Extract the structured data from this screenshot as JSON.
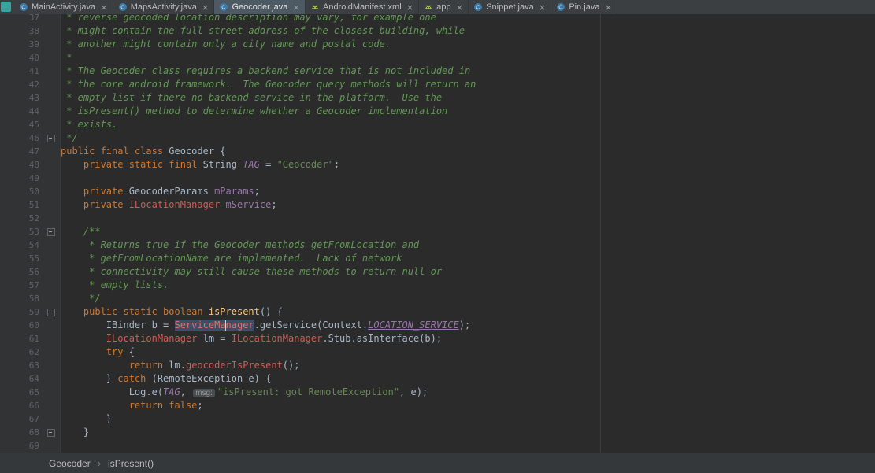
{
  "theme": {
    "background": "#2B2B2B",
    "gutter": "#313335",
    "tab_bar": "#3C3F41",
    "active_tab": "#4D5A63",
    "keyword": "#CC7832",
    "string": "#6A8759",
    "comment": "#629755",
    "error": "#CF5B56",
    "field": "#9876AA",
    "method": "#FFC66D",
    "default_text": "#A9B7C6",
    "selection": "#3A5067",
    "android_icon_green": "#9FBF3B",
    "class_icon_blue": "#3C7BA8",
    "corner_icon_teal": "#3AA3A0"
  },
  "tabs": [
    {
      "label": "MainActivity.java",
      "icon": "class",
      "active": false
    },
    {
      "label": "MapsActivity.java",
      "icon": "class",
      "active": false
    },
    {
      "label": "Geocoder.java",
      "icon": "class",
      "active": true
    },
    {
      "label": "AndroidManifest.xml",
      "icon": "android",
      "active": false
    },
    {
      "label": "app",
      "icon": "android",
      "active": false
    },
    {
      "label": "Snippet.java",
      "icon": "class",
      "active": false
    },
    {
      "label": "Pin.java",
      "icon": "class",
      "active": false
    }
  ],
  "breadcrumbs": [
    "Geocoder",
    "isPresent()"
  ],
  "editor": {
    "lines": [
      {
        "num": 37,
        "fold": null,
        "tokens": [
          {
            "t": " * reverse geocoded location description may vary, for example one",
            "c": "com"
          }
        ]
      },
      {
        "num": 38,
        "fold": null,
        "tokens": [
          {
            "t": " * might contain the full street address of the closest building, while",
            "c": "com"
          }
        ]
      },
      {
        "num": 39,
        "fold": null,
        "tokens": [
          {
            "t": " * another might contain only a city name and postal code.",
            "c": "com"
          }
        ]
      },
      {
        "num": 40,
        "fold": null,
        "tokens": [
          {
            "t": " *",
            "c": "com"
          }
        ]
      },
      {
        "num": 41,
        "fold": null,
        "tokens": [
          {
            "t": " * The Geocoder class requires a backend service that is not included in",
            "c": "com"
          }
        ]
      },
      {
        "num": 42,
        "fold": null,
        "tokens": [
          {
            "t": " * the core android framework.  The Geocoder query methods will return an",
            "c": "com"
          }
        ]
      },
      {
        "num": 43,
        "fold": null,
        "tokens": [
          {
            "t": " * empty list if there no backend service in the platform.  Use the",
            "c": "com"
          }
        ]
      },
      {
        "num": 44,
        "fold": null,
        "tokens": [
          {
            "t": " * isPresent() method to determine whether a Geocoder implementation",
            "c": "com"
          }
        ]
      },
      {
        "num": 45,
        "fold": null,
        "tokens": [
          {
            "t": " * exists.",
            "c": "com"
          }
        ]
      },
      {
        "num": 46,
        "fold": "minus",
        "tokens": [
          {
            "t": " */",
            "c": "com"
          }
        ]
      },
      {
        "num": 47,
        "fold": null,
        "tokens": [
          {
            "t": "public final class ",
            "c": "kw"
          },
          {
            "t": "Geocoder {",
            "c": "def"
          }
        ]
      },
      {
        "num": 48,
        "fold": null,
        "tokens": [
          {
            "t": "    ",
            "c": "def"
          },
          {
            "t": "private static final ",
            "c": "kw"
          },
          {
            "t": "String ",
            "c": "def"
          },
          {
            "t": "TAG",
            "c": "sfld"
          },
          {
            "t": " = ",
            "c": "def"
          },
          {
            "t": "\"Geocoder\"",
            "c": "str"
          },
          {
            "t": ";",
            "c": "def"
          }
        ]
      },
      {
        "num": 49,
        "fold": null,
        "tokens": []
      },
      {
        "num": 50,
        "fold": null,
        "tokens": [
          {
            "t": "    ",
            "c": "def"
          },
          {
            "t": "private ",
            "c": "kw"
          },
          {
            "t": "GeocoderParams ",
            "c": "def"
          },
          {
            "t": "mParams",
            "c": "fld"
          },
          {
            "t": ";",
            "c": "def"
          }
        ]
      },
      {
        "num": 51,
        "fold": null,
        "tokens": [
          {
            "t": "    ",
            "c": "def"
          },
          {
            "t": "private ",
            "c": "kw"
          },
          {
            "t": "ILocationManager",
            "c": "err"
          },
          {
            "t": " ",
            "c": "def"
          },
          {
            "t": "mService",
            "c": "fld"
          },
          {
            "t": ";",
            "c": "def"
          }
        ]
      },
      {
        "num": 52,
        "fold": null,
        "tokens": []
      },
      {
        "num": 53,
        "fold": "minus",
        "tokens": [
          {
            "t": "    /**",
            "c": "com"
          }
        ]
      },
      {
        "num": 54,
        "fold": null,
        "tokens": [
          {
            "t": "     * Returns true if the Geocoder methods getFromLocation and",
            "c": "com"
          }
        ]
      },
      {
        "num": 55,
        "fold": null,
        "tokens": [
          {
            "t": "     * getFromLocationName are implemented.  Lack of network",
            "c": "com"
          }
        ]
      },
      {
        "num": 56,
        "fold": null,
        "tokens": [
          {
            "t": "     * connectivity may still cause these methods to return null or",
            "c": "com"
          }
        ]
      },
      {
        "num": 57,
        "fold": null,
        "tokens": [
          {
            "t": "     * empty lists.",
            "c": "com"
          }
        ]
      },
      {
        "num": 58,
        "fold": null,
        "tokens": [
          {
            "t": "     */",
            "c": "com"
          }
        ]
      },
      {
        "num": 59,
        "fold": "minus",
        "tokens": [
          {
            "t": "    ",
            "c": "def"
          },
          {
            "t": "public static boolean ",
            "c": "kw"
          },
          {
            "t": "isPresent",
            "c": "meth"
          },
          {
            "t": "() {",
            "c": "def"
          }
        ]
      },
      {
        "num": 60,
        "fold": null,
        "tokens": [
          {
            "t": "        IBinder b = ",
            "c": "def"
          },
          {
            "t": "ServiceMa",
            "c": "errsel"
          },
          {
            "t": "",
            "c": "caret"
          },
          {
            "t": "nager",
            "c": "errsel"
          },
          {
            "t": ".getService(Context.",
            "c": "def"
          },
          {
            "t": "LOCATION_SERVICE",
            "c": "cst"
          },
          {
            "t": ");",
            "c": "def"
          }
        ]
      },
      {
        "num": 61,
        "fold": null,
        "tokens": [
          {
            "t": "        ",
            "c": "def"
          },
          {
            "t": "ILocationManager",
            "c": "err"
          },
          {
            "t": " lm = ",
            "c": "def"
          },
          {
            "t": "ILocationManager",
            "c": "err"
          },
          {
            "t": ".Stub.asInterface(b);",
            "c": "def"
          }
        ]
      },
      {
        "num": 62,
        "fold": null,
        "tokens": [
          {
            "t": "        ",
            "c": "def"
          },
          {
            "t": "try ",
            "c": "kw"
          },
          {
            "t": "{",
            "c": "def"
          }
        ]
      },
      {
        "num": 63,
        "fold": null,
        "tokens": [
          {
            "t": "            ",
            "c": "def"
          },
          {
            "t": "return ",
            "c": "kw"
          },
          {
            "t": "lm.",
            "c": "def"
          },
          {
            "t": "geocoderIsPresent",
            "c": "err"
          },
          {
            "t": "();",
            "c": "def"
          }
        ]
      },
      {
        "num": 64,
        "fold": null,
        "tokens": [
          {
            "t": "        } ",
            "c": "def"
          },
          {
            "t": "catch ",
            "c": "kw"
          },
          {
            "t": "(RemoteException e) {",
            "c": "def"
          }
        ]
      },
      {
        "num": 65,
        "fold": null,
        "tokens": [
          {
            "t": "            Log.e(",
            "c": "def"
          },
          {
            "t": "TAG",
            "c": "sfld"
          },
          {
            "t": ", ",
            "c": "def"
          },
          {
            "t": "msg:",
            "c": "hint"
          },
          {
            "t": "\"isPresent: got RemoteException\"",
            "c": "str"
          },
          {
            "t": ", e);",
            "c": "def"
          }
        ]
      },
      {
        "num": 66,
        "fold": null,
        "tokens": [
          {
            "t": "            ",
            "c": "def"
          },
          {
            "t": "return false",
            "c": "kw"
          },
          {
            "t": ";",
            "c": "def"
          }
        ]
      },
      {
        "num": 67,
        "fold": null,
        "tokens": [
          {
            "t": "        }",
            "c": "def"
          }
        ]
      },
      {
        "num": 68,
        "fold": "minus",
        "tokens": [
          {
            "t": "    }",
            "c": "def"
          }
        ]
      },
      {
        "num": 69,
        "fold": null,
        "tokens": []
      }
    ]
  }
}
